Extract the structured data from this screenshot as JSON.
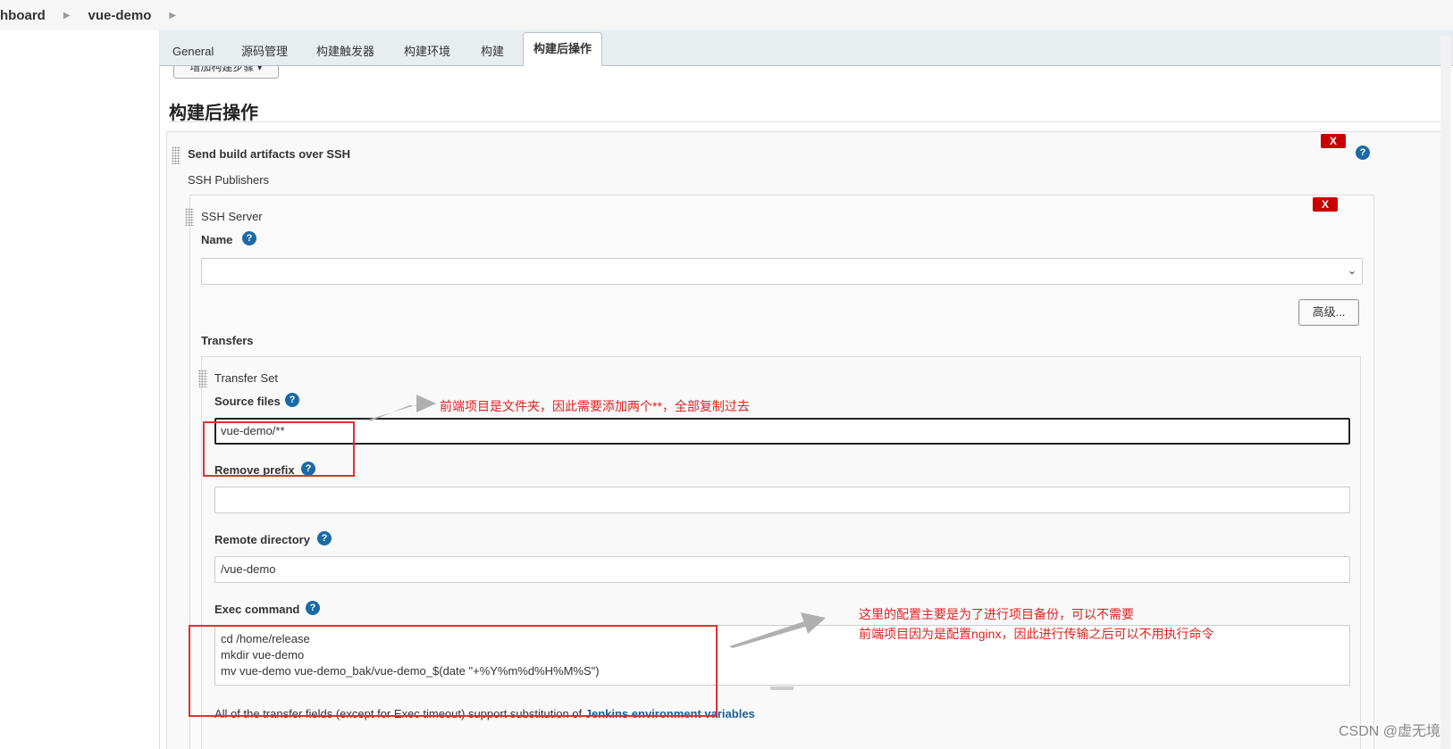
{
  "breadcrumb": {
    "items": [
      "hboard",
      "vue-demo"
    ]
  },
  "tabs": [
    "General",
    "源码管理",
    "构建触发器",
    "构建环境",
    "构建",
    "构建后操作"
  ],
  "add_step_label": "增加构建步骤 ▾",
  "section_title": "构建后操作",
  "publisher": {
    "title": "Send build artifacts over SSH",
    "publishers_label": "SSH Publishers",
    "server_label": "SSH Server",
    "name_label": "Name",
    "name_value": "",
    "advanced_button": "高级...",
    "transfers_label": "Transfers",
    "transfer_set_label": "Transfer Set",
    "source_files_label": "Source files",
    "source_files_value": "vue-demo/**",
    "remove_prefix_label": "Remove prefix",
    "remove_prefix_value": "",
    "remote_directory_label": "Remote directory",
    "remote_directory_value": "/vue-demo",
    "exec_command_label": "Exec command",
    "exec_command_value": "cd /home/release\nmkdir vue-demo\nmv vue-demo vue-demo_bak/vue-demo_$(date \"+%Y%m%d%H%M%S\")",
    "footer_text": "All of the transfer fields (except for Exec timeout) support substitution of ",
    "footer_link": "Jenkins environment variables",
    "delete_label": "X",
    "help_label": "?"
  },
  "annotations": {
    "note1": "前端项目是文件夹，因此需要添加两个**，全部复制过去",
    "note2_line1": "这里的配置主要是为了进行项目备份，可以不需要",
    "note2_line2": "前端项目因为是配置nginx，因此进行传输之后可以不用执行命令"
  },
  "watermark": "CSDN @虚无境",
  "colors": {
    "annotation": "#e02020",
    "delete": "#c80000",
    "help": "#1a6aa6"
  }
}
